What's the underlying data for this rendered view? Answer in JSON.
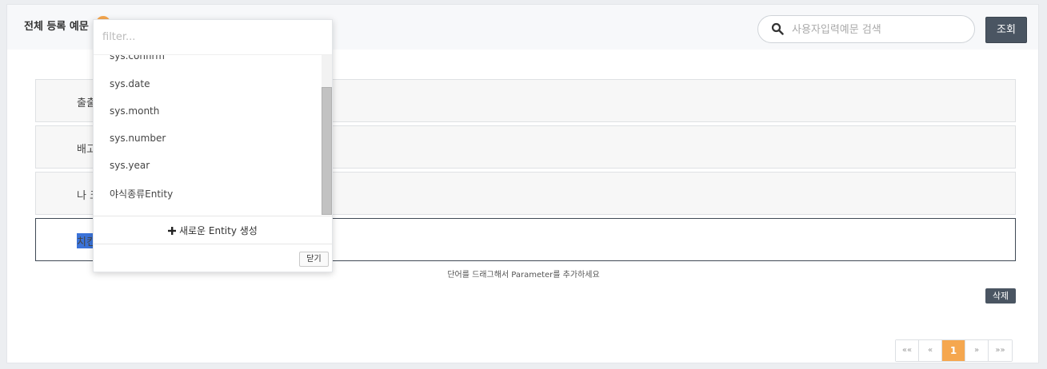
{
  "header": {
    "title": "전체 등록 예문",
    "badge": ""
  },
  "search": {
    "placeholder": "사용자입력예문 검색",
    "button_label": "조회"
  },
  "utterances": [
    {
      "text": "출출"
    },
    {
      "text": "배고"
    },
    {
      "text": "나 크"
    },
    {
      "text": "치킨",
      "selected": true
    }
  ],
  "hint": "단어를 드래그해서 Parameter를 추가하세요",
  "delete_label": "삭제",
  "pagination": {
    "first": "««",
    "prev": "«",
    "current": "1",
    "next": "»",
    "last": "»»"
  },
  "entity_dropdown": {
    "filter_placeholder": "filter...",
    "options": [
      "sys.confirm",
      "sys.date",
      "sys.month",
      "sys.number",
      "sys.year",
      "야식종류Entity"
    ],
    "new_entity_label": "새로운 Entity 생성",
    "close_label": "닫기"
  }
}
